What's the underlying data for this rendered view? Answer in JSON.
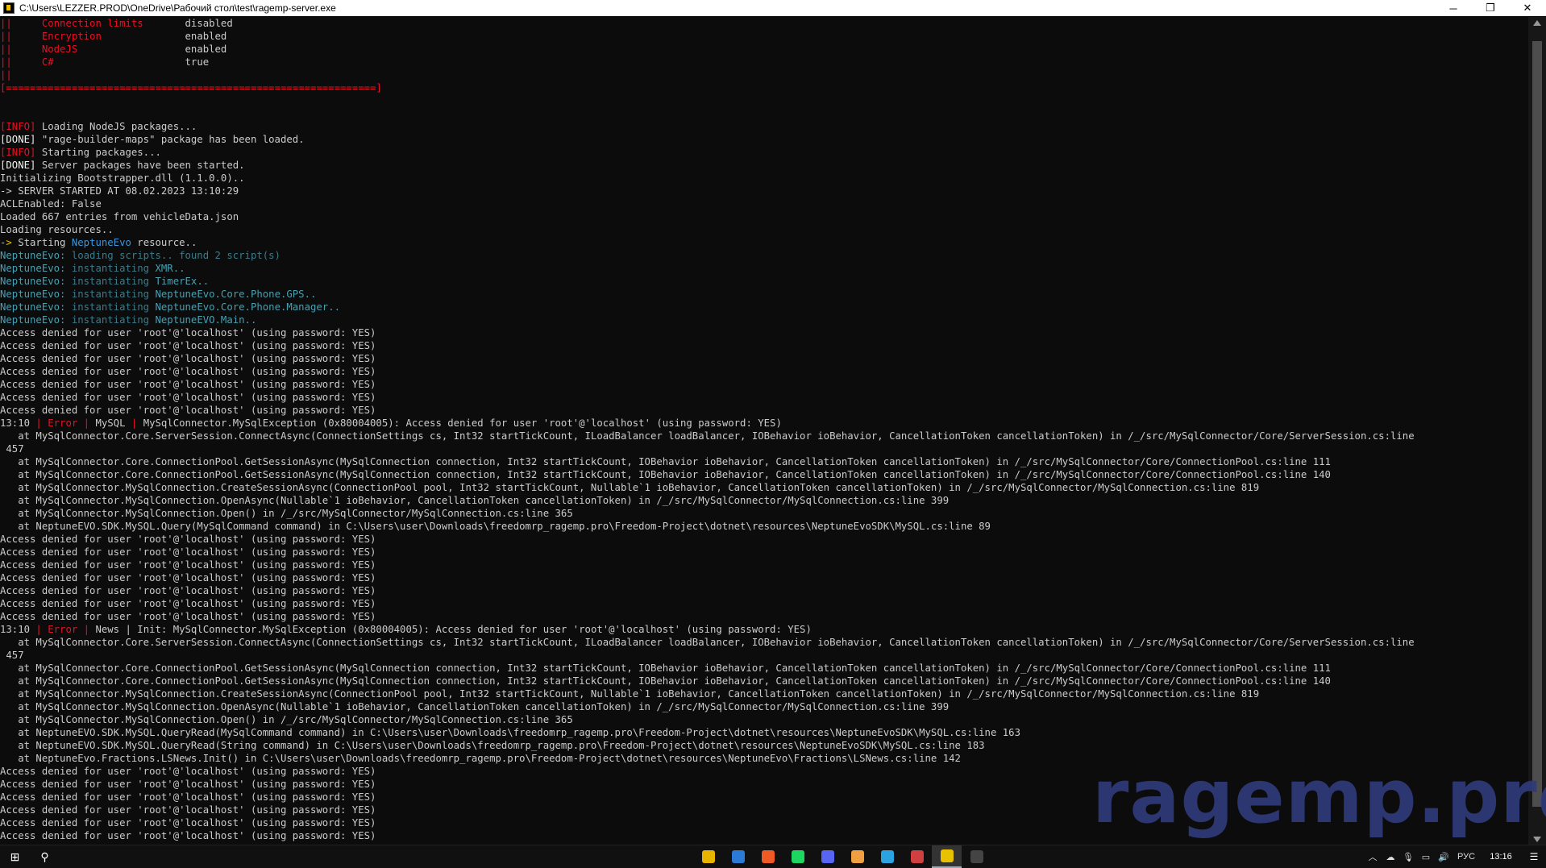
{
  "window": {
    "title": "C:\\Users\\LEZZER.PROD\\OneDrive\\Рабочий стол\\test\\ragemp-server.exe",
    "minimize_glyph": "─",
    "maximize_glyph": "❐",
    "close_glyph": "✕"
  },
  "console": {
    "lines": [
      [
        {
          "t": "||     ",
          "c": "red"
        },
        {
          "t": "Connection limits       ",
          "c": "red"
        },
        {
          "t": "disabled",
          "c": ""
        }
      ],
      [
        {
          "t": "||     ",
          "c": "red"
        },
        {
          "t": "Encryption              ",
          "c": "red"
        },
        {
          "t": "enabled",
          "c": ""
        }
      ],
      [
        {
          "t": "||     ",
          "c": "red"
        },
        {
          "t": "NodeJS                  ",
          "c": "red"
        },
        {
          "t": "enabled",
          "c": ""
        }
      ],
      [
        {
          "t": "||     ",
          "c": "red"
        },
        {
          "t": "C#                      ",
          "c": "red"
        },
        {
          "t": "true",
          "c": ""
        }
      ],
      [
        {
          "t": "||",
          "c": "red"
        }
      ],
      [
        {
          "t": "[==============================================================]",
          "c": "red"
        }
      ],
      [],
      [],
      [
        {
          "t": "[INFO]",
          "c": "red"
        },
        {
          "t": " Loading NodeJS packages...",
          "c": ""
        }
      ],
      [
        {
          "t": "[DONE]",
          "c": "white"
        },
        {
          "t": " \"rage-builder-maps\" package has been loaded.",
          "c": ""
        }
      ],
      [
        {
          "t": "[INFO]",
          "c": "red"
        },
        {
          "t": " Starting packages...",
          "c": ""
        }
      ],
      [
        {
          "t": "[DONE]",
          "c": "white"
        },
        {
          "t": " Server packages have been started.",
          "c": ""
        }
      ],
      [
        {
          "t": "Initializing Bootstrapper.dll (1.1.0.0)..",
          "c": ""
        }
      ],
      [
        {
          "t": "-> SERVER STARTED AT 08.02.2023 13:10:29",
          "c": ""
        }
      ],
      [
        {
          "t": "ACLEnabled: False",
          "c": ""
        }
      ],
      [
        {
          "t": "Loaded 667 entries from vehicleData.json",
          "c": ""
        }
      ],
      [
        {
          "t": "Loading resources..",
          "c": ""
        }
      ],
      [
        {
          "t": "->",
          "c": "yellow"
        },
        {
          "t": " Starting ",
          "c": ""
        },
        {
          "t": "NeptuneEvo",
          "c": "cyan"
        },
        {
          "t": " resource..",
          "c": ""
        }
      ],
      [
        {
          "t": "NeptuneEvo:",
          "c": "teal"
        },
        {
          "t": " loading scripts.. found 2 script(s)",
          "c": "steel"
        }
      ],
      [
        {
          "t": "NeptuneEvo:",
          "c": "teal"
        },
        {
          "t": " instantiating ",
          "c": "steel"
        },
        {
          "t": "XMR..",
          "c": "teal"
        }
      ],
      [
        {
          "t": "NeptuneEvo:",
          "c": "teal"
        },
        {
          "t": " instantiating ",
          "c": "steel"
        },
        {
          "t": "TimerEx..",
          "c": "teal"
        }
      ],
      [
        {
          "t": "NeptuneEvo:",
          "c": "teal"
        },
        {
          "t": " instantiating ",
          "c": "steel"
        },
        {
          "t": "NeptuneEvo.Core.Phone.GPS..",
          "c": "teal"
        }
      ],
      [
        {
          "t": "NeptuneEvo:",
          "c": "teal"
        },
        {
          "t": " instantiating ",
          "c": "steel"
        },
        {
          "t": "NeptuneEvo.Core.Phone.Manager..",
          "c": "teal"
        }
      ],
      [
        {
          "t": "NeptuneEvo:",
          "c": "teal"
        },
        {
          "t": " instantiating ",
          "c": "steel"
        },
        {
          "t": "NeptuneEVO.Main..",
          "c": "teal"
        }
      ],
      [
        {
          "t": "Access denied for user 'root'@'localhost' (using password: YES)",
          "c": ""
        }
      ],
      [
        {
          "t": "Access denied for user 'root'@'localhost' (using password: YES)",
          "c": ""
        }
      ],
      [
        {
          "t": "Access denied for user 'root'@'localhost' (using password: YES)",
          "c": ""
        }
      ],
      [
        {
          "t": "Access denied for user 'root'@'localhost' (using password: YES)",
          "c": ""
        }
      ],
      [
        {
          "t": "Access denied for user 'root'@'localhost' (using password: YES)",
          "c": ""
        }
      ],
      [
        {
          "t": "Access denied for user 'root'@'localhost' (using password: YES)",
          "c": ""
        }
      ],
      [
        {
          "t": "Access denied for user 'root'@'localhost' (using password: YES)",
          "c": ""
        }
      ],
      [
        {
          "t": "13:10 ",
          "c": ""
        },
        {
          "t": "| Error |",
          "c": "red"
        },
        {
          "t": " MySQL ",
          "c": ""
        },
        {
          "t": "|",
          "c": "red"
        },
        {
          "t": " MySqlConnector.MySqlException (0x80004005): Access denied for user 'root'@'localhost' (using password: YES)",
          "c": ""
        }
      ],
      [
        {
          "t": "   at MySqlConnector.Core.ServerSession.ConnectAsync(ConnectionSettings cs, Int32 startTickCount, ILoadBalancer loadBalancer, IOBehavior ioBehavior, CancellationToken cancellationToken) in /_/src/MySqlConnector/Core/ServerSession.cs:line",
          "c": ""
        }
      ],
      [
        {
          "t": " 457",
          "c": ""
        }
      ],
      [
        {
          "t": "   at MySqlConnector.Core.ConnectionPool.GetSessionAsync(MySqlConnection connection, Int32 startTickCount, IOBehavior ioBehavior, CancellationToken cancellationToken) in /_/src/MySqlConnector/Core/ConnectionPool.cs:line 111",
          "c": ""
        }
      ],
      [
        {
          "t": "   at MySqlConnector.Core.ConnectionPool.GetSessionAsync(MySqlConnection connection, Int32 startTickCount, IOBehavior ioBehavior, CancellationToken cancellationToken) in /_/src/MySqlConnector/Core/ConnectionPool.cs:line 140",
          "c": ""
        }
      ],
      [
        {
          "t": "   at MySqlConnector.MySqlConnection.CreateSessionAsync(ConnectionPool pool, Int32 startTickCount, Nullable`1 ioBehavior, CancellationToken cancellationToken) in /_/src/MySqlConnector/MySqlConnection.cs:line 819",
          "c": ""
        }
      ],
      [
        {
          "t": "   at MySqlConnector.MySqlConnection.OpenAsync(Nullable`1 ioBehavior, CancellationToken cancellationToken) in /_/src/MySqlConnector/MySqlConnection.cs:line 399",
          "c": ""
        }
      ],
      [
        {
          "t": "   at MySqlConnector.MySqlConnection.Open() in /_/src/MySqlConnector/MySqlConnection.cs:line 365",
          "c": ""
        }
      ],
      [
        {
          "t": "   at NeptuneEVO.SDK.MySQL.Query(MySqlCommand command) in C:\\Users\\user\\Downloads\\freedomrp_ragemp.pro\\Freedom-Project\\dotnet\\resources\\NeptuneEvoSDK\\MySQL.cs:line 89",
          "c": ""
        }
      ],
      [
        {
          "t": "Access denied for user 'root'@'localhost' (using password: YES)",
          "c": ""
        }
      ],
      [
        {
          "t": "Access denied for user 'root'@'localhost' (using password: YES)",
          "c": ""
        }
      ],
      [
        {
          "t": "Access denied for user 'root'@'localhost' (using password: YES)",
          "c": ""
        }
      ],
      [
        {
          "t": "Access denied for user 'root'@'localhost' (using password: YES)",
          "c": ""
        }
      ],
      [
        {
          "t": "Access denied for user 'root'@'localhost' (using password: YES)",
          "c": ""
        }
      ],
      [
        {
          "t": "Access denied for user 'root'@'localhost' (using password: YES)",
          "c": ""
        }
      ],
      [
        {
          "t": "Access denied for user 'root'@'localhost' (using password: YES)",
          "c": ""
        }
      ],
      [
        {
          "t": "13:10 ",
          "c": ""
        },
        {
          "t": "| Error |",
          "c": "red"
        },
        {
          "t": " News | Init: MySqlConnector.MySqlException (0x80004005): Access denied for user 'root'@'localhost' (using password: YES)",
          "c": ""
        }
      ],
      [
        {
          "t": "   at MySqlConnector.Core.ServerSession.ConnectAsync(ConnectionSettings cs, Int32 startTickCount, ILoadBalancer loadBalancer, IOBehavior ioBehavior, CancellationToken cancellationToken) in /_/src/MySqlConnector/Core/ServerSession.cs:line",
          "c": ""
        }
      ],
      [
        {
          "t": " 457",
          "c": ""
        }
      ],
      [
        {
          "t": "   at MySqlConnector.Core.ConnectionPool.GetSessionAsync(MySqlConnection connection, Int32 startTickCount, IOBehavior ioBehavior, CancellationToken cancellationToken) in /_/src/MySqlConnector/Core/ConnectionPool.cs:line 111",
          "c": ""
        }
      ],
      [
        {
          "t": "   at MySqlConnector.Core.ConnectionPool.GetSessionAsync(MySqlConnection connection, Int32 startTickCount, IOBehavior ioBehavior, CancellationToken cancellationToken) in /_/src/MySqlConnector/Core/ConnectionPool.cs:line 140",
          "c": ""
        }
      ],
      [
        {
          "t": "   at MySqlConnector.MySqlConnection.CreateSessionAsync(ConnectionPool pool, Int32 startTickCount, Nullable`1 ioBehavior, CancellationToken cancellationToken) in /_/src/MySqlConnector/MySqlConnection.cs:line 819",
          "c": ""
        }
      ],
      [
        {
          "t": "   at MySqlConnector.MySqlConnection.OpenAsync(Nullable`1 ioBehavior, CancellationToken cancellationToken) in /_/src/MySqlConnector/MySqlConnection.cs:line 399",
          "c": ""
        }
      ],
      [
        {
          "t": "   at MySqlConnector.MySqlConnection.Open() in /_/src/MySqlConnector/MySqlConnection.cs:line 365",
          "c": ""
        }
      ],
      [
        {
          "t": "   at NeptuneEVO.SDK.MySQL.QueryRead(MySqlCommand command) in C:\\Users\\user\\Downloads\\freedomrp_ragemp.pro\\Freedom-Project\\dotnet\\resources\\NeptuneEvoSDK\\MySQL.cs:line 163",
          "c": ""
        }
      ],
      [
        {
          "t": "   at NeptuneEVO.SDK.MySQL.QueryRead(String command) in C:\\Users\\user\\Downloads\\freedomrp_ragemp.pro\\Freedom-Project\\dotnet\\resources\\NeptuneEvoSDK\\MySQL.cs:line 183",
          "c": ""
        }
      ],
      [
        {
          "t": "   at NeptuneEvo.Fractions.LSNews.Init() in C:\\Users\\user\\Downloads\\freedomrp_ragemp.pro\\Freedom-Project\\dotnet\\resources\\NeptuneEvo\\Fractions\\LSNews.cs:line 142",
          "c": ""
        }
      ],
      [
        {
          "t": "Access denied for user 'root'@'localhost' (using password: YES)",
          "c": ""
        }
      ],
      [
        {
          "t": "Access denied for user 'root'@'localhost' (using password: YES)",
          "c": ""
        }
      ],
      [
        {
          "t": "Access denied for user 'root'@'localhost' (using password: YES)",
          "c": ""
        }
      ],
      [
        {
          "t": "Access denied for user 'root'@'localhost' (using password: YES)",
          "c": ""
        }
      ],
      [
        {
          "t": "Access denied for user 'root'@'localhost' (using password: YES)",
          "c": ""
        }
      ],
      [
        {
          "t": "Access denied for user 'root'@'localhost' (using password: YES)",
          "c": ""
        }
      ]
    ]
  },
  "watermark": "ragemp.pro",
  "taskbar": {
    "start_glyph": "⊞",
    "search_glyph": "⚲",
    "pinned": [
      {
        "name": "file-explorer",
        "color": "#e8b400",
        "active": false
      },
      {
        "name": "vscode",
        "color": "#2a7ad6",
        "active": false
      },
      {
        "name": "brave",
        "color": "#f05a24",
        "active": false
      },
      {
        "name": "spotify",
        "color": "#1ed760",
        "active": false
      },
      {
        "name": "discord",
        "color": "#5865f2",
        "active": false
      },
      {
        "name": "app-orange",
        "color": "#f0a040",
        "active": false
      },
      {
        "name": "telegram",
        "color": "#2aa3e0",
        "active": false
      },
      {
        "name": "app-grid",
        "color": "#d04040",
        "active": false
      },
      {
        "name": "ragemp-server",
        "color": "#e8c100",
        "active": true
      },
      {
        "name": "epic-games",
        "color": "#444444",
        "active": false
      }
    ],
    "tray": {
      "chevron": "︿",
      "language": "РУС",
      "time": "13:16",
      "notification_glyph": "☰"
    }
  },
  "colors": {
    "console_bg": "#0c0c0c",
    "console_text": "#cccccc",
    "error_red": "#e81123",
    "cyan": "#3a96dd",
    "watermark": "#2f3b7a"
  }
}
